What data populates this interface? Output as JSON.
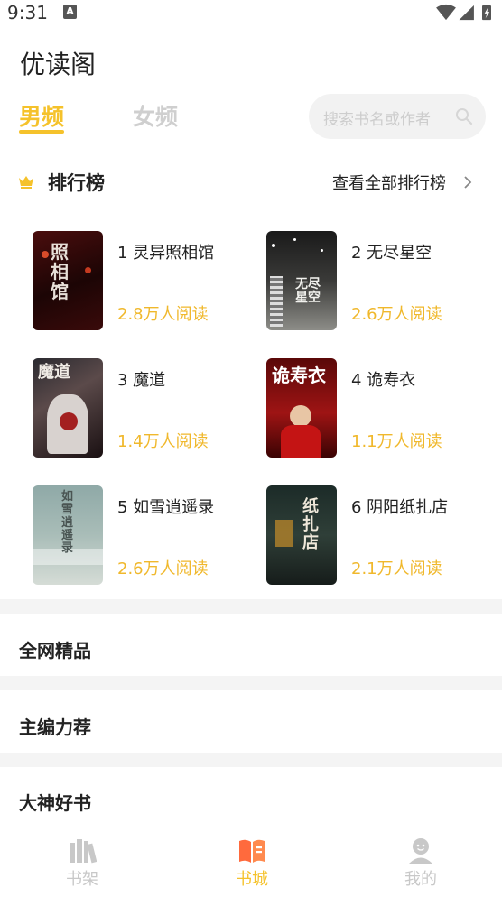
{
  "status_bar": {
    "time": "9:31",
    "notification_letter": "A"
  },
  "app": {
    "title": "优读阁"
  },
  "tabs": [
    {
      "label": "男频",
      "active": true
    },
    {
      "label": "女频",
      "active": false
    }
  ],
  "search": {
    "placeholder": "搜索书名或作者"
  },
  "ranking": {
    "title": "排行榜",
    "view_all": "查看全部排行榜",
    "books": [
      {
        "name": "1 灵异照相馆",
        "reads": "2.8万人阅读",
        "cover_text": "照相馆"
      },
      {
        "name": "2 无尽星空",
        "reads": "2.6万人阅读",
        "cover_text": "无尽星空"
      },
      {
        "name": "3 魔道",
        "reads": "1.4万人阅读",
        "cover_text": "魔道"
      },
      {
        "name": "4 诡寿衣",
        "reads": "1.1万人阅读",
        "cover_text": "诡寿衣"
      },
      {
        "name": "5 如雪逍遥录",
        "reads": "2.6万人阅读",
        "cover_text": "如雪逍遥录"
      },
      {
        "name": "6 阴阳纸扎店",
        "reads": "2.1万人阅读",
        "cover_text": "纸扎店"
      }
    ]
  },
  "sections": [
    {
      "title": "全网精品"
    },
    {
      "title": "主编力荐"
    },
    {
      "title": "大神好书"
    }
  ],
  "bottom_nav": [
    {
      "label": "书架",
      "icon": "bookshelf-icon",
      "active": false
    },
    {
      "label": "书城",
      "icon": "bookstore-icon",
      "active": true
    },
    {
      "label": "我的",
      "icon": "profile-icon",
      "active": false
    }
  ],
  "colors": {
    "accent": "#f5c22b",
    "reads": "#f0b82c",
    "inactive": "#cfcfcf"
  }
}
